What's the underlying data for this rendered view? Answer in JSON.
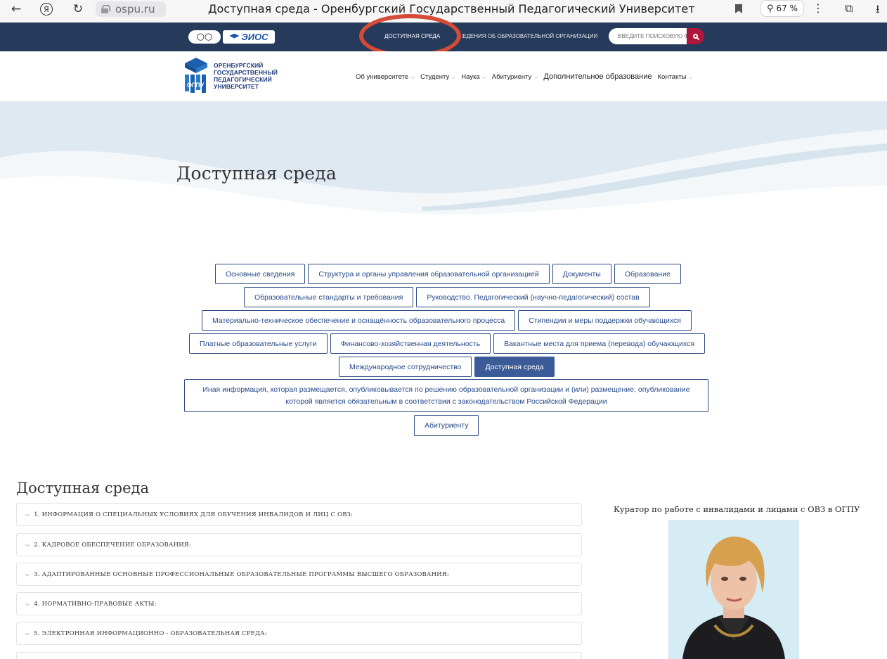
{
  "browser": {
    "url": "ospu.ru",
    "title": "Доступная среда - Оренбургский Государственный Педагогический Университет",
    "zoom": "67 %"
  },
  "topbar": {
    "active_link": "Доступная среда",
    "info_link": "Сведения об образовательной организации",
    "eios_label": "ЭИОС",
    "search_placeholder": "Введите поисковую фразу"
  },
  "logo": {
    "lines": [
      "Оренбургский",
      "Государственный",
      "Педагогический",
      "Университет"
    ]
  },
  "menu": [
    {
      "label": "Об университете",
      "has_dropdown": true
    },
    {
      "label": "Студенту",
      "has_dropdown": true
    },
    {
      "label": "Наука",
      "has_dropdown": true
    },
    {
      "label": "Абитуриенту",
      "has_dropdown": true
    },
    {
      "label": "Дополнительное образование",
      "has_dropdown": false
    },
    {
      "label": "Контакты",
      "has_dropdown": true
    }
  ],
  "hero": {
    "title": "Доступная среда"
  },
  "sections": {
    "row1": [
      "Основные сведения",
      "Структура и органы управления образовательной организацией",
      "Документы",
      "Образование"
    ],
    "row2": [
      "Образовательные стандарты и требования",
      "Руководство. Педагогический (научно-педагогический) состав"
    ],
    "row3": [
      "Материально-техническое обеспечение и оснащённость образовательного процесса",
      "Стипендии и меры поддержки обучающихся"
    ],
    "row4": [
      "Платные образовательные услуги",
      "Финансово-хозяйственная деятельность",
      "Вакантные места для приема (перевода) обучающихся"
    ],
    "row5": [
      "Международное сотрудничество",
      "Доступная среда"
    ],
    "row6": "Иная информация, которая размещается, опубликовывается по решению образовательной организации и (или) размещение, опубликование которой является обязательным в соответствии с законодательством Российской Федерации",
    "row7": "Абитуриенту",
    "active": "Доступная среда"
  },
  "content": {
    "title": "Доступная среда",
    "accordion": [
      "1. Информация о специальных условиях для обучения инвалидов и лиц с ОВЗ:",
      "2. Кадровое обеспечение образования:",
      "3. Адаптированные основные профессиональные образовательные программы высшего образования:",
      "4. Нормативно-правовые акты:",
      "5. Электронная информационно - образовательная среда:"
    ],
    "curator_caption": "Куратор по работе с инвалидами и лицами с ОВЗ в ОГПУ"
  },
  "colors": {
    "topbar": "#263a5c",
    "accent_red": "#b0163d",
    "button_border": "#2d4d86",
    "button_active": "#3a5b98",
    "highlight_ring": "#d64b36"
  }
}
